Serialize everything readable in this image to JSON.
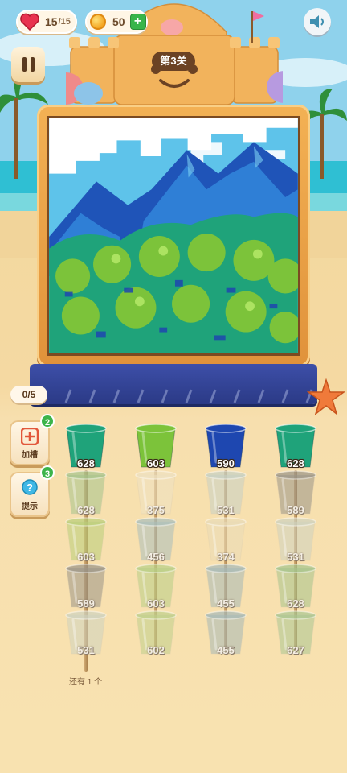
{
  "hud": {
    "lives": "15",
    "lives_max": "/15",
    "coins": "50",
    "plus": "+"
  },
  "level": {
    "label": "第3关"
  },
  "progress": {
    "text": "0/5"
  },
  "tools": [
    {
      "name": "add-slot",
      "label": "加槽",
      "count": "2",
      "icon": "plus-square-icon"
    },
    {
      "name": "hint",
      "label": "提示",
      "count": "3",
      "icon": "question-icon"
    }
  ],
  "colors": {
    "accent_green": "#3cb44a",
    "frame": "#e89c45",
    "stand": "#2f3f8f",
    "teal": "#1fa37a",
    "lime": "#7cc33a",
    "blue": "#1e47b0"
  },
  "cups": {
    "columns": [
      {
        "top": {
          "value": "628",
          "color": "#1fa37a"
        },
        "stack": [
          {
            "value": "628",
            "color": "#a5c48c"
          },
          {
            "value": "603",
            "color": "#b9cf7a"
          },
          {
            "value": "589",
            "color": "#9a9488"
          },
          {
            "value": "531",
            "color": "#cfd3c0"
          }
        ]
      },
      {
        "top": {
          "value": "603",
          "color": "#7cc33a"
        },
        "stack": [
          {
            "value": "375",
            "color": "#efe2c2"
          },
          {
            "value": "456",
            "color": "#a9bfbd"
          },
          {
            "value": "603",
            "color": "#b8cf86"
          },
          {
            "value": "602",
            "color": "#bfd08c"
          }
        ]
      },
      {
        "top": {
          "value": "590",
          "color": "#1e47b0"
        },
        "stack": [
          {
            "value": "531",
            "color": "#c6d1c6"
          },
          {
            "value": "374",
            "color": "#eadcb8"
          },
          {
            "value": "455",
            "color": "#a6b9b8"
          },
          {
            "value": "455",
            "color": "#a6b9b8"
          }
        ]
      },
      {
        "top": {
          "value": "628",
          "color": "#1fa37a"
        },
        "stack": [
          {
            "value": "589",
            "color": "#9a9488"
          },
          {
            "value": "531",
            "color": "#cfd3c0"
          },
          {
            "value": "628",
            "color": "#a5c48c"
          },
          {
            "value": "627",
            "color": "#a9c692"
          }
        ]
      }
    ]
  },
  "remaining_text": "还有 1 个"
}
